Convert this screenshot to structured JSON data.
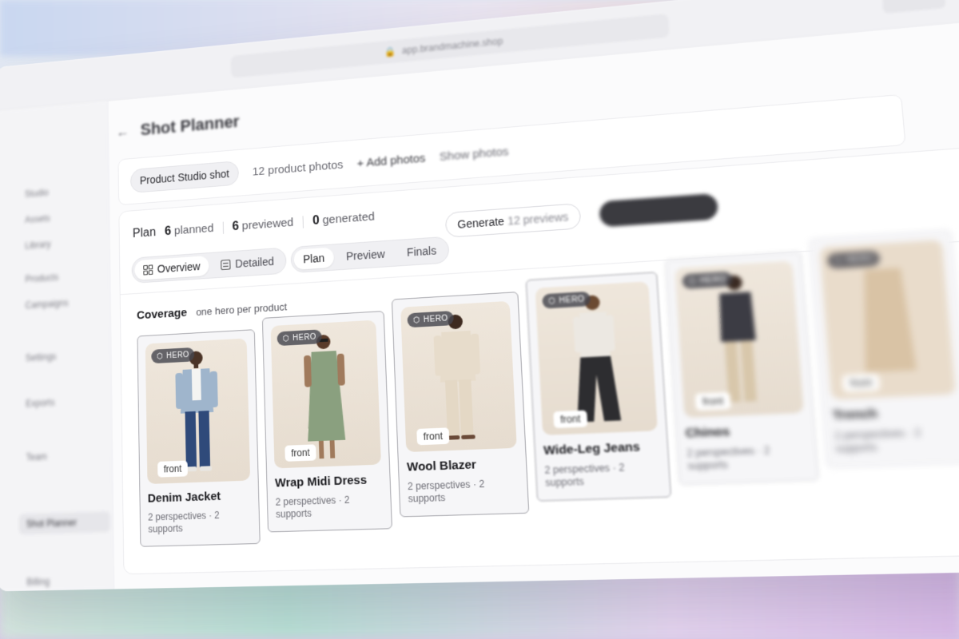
{
  "browser": {
    "url": "app.brandmachine.shop"
  },
  "sidebar": {
    "items": [
      "Studio",
      "Assets",
      "Library",
      "Products",
      "Campaigns",
      "Shot Planner",
      "Settings",
      "Exports",
      "Team",
      "Billing"
    ]
  },
  "header": {
    "back_label": "←",
    "title": "Shot Planner"
  },
  "toolbar": {
    "shot_type": "Product Studio shot",
    "photo_count": "12 product photos",
    "add_photos": "+ Add photos",
    "show_photos": "Show photos"
  },
  "plan": {
    "label": "Plan",
    "planned_count": "6",
    "planned_label": "planned",
    "previewed_count": "6",
    "previewed_label": "previewed",
    "generated_count": "0",
    "generated_label": "generated",
    "view_toggle": [
      {
        "label": "Overview",
        "icon": "grid-icon",
        "active": true
      },
      {
        "label": "Detailed",
        "icon": "list-icon",
        "active": false
      }
    ],
    "stage_tabs": [
      {
        "label": "Plan",
        "active": true
      },
      {
        "label": "Preview",
        "active": false
      },
      {
        "label": "Finals",
        "active": false
      }
    ],
    "generate_previews_prefix": "Generate",
    "generate_previews_suffix": "12 previews"
  },
  "coverage": {
    "title": "Coverage",
    "subtitle": "one hero per product"
  },
  "products": [
    {
      "name": "Denim Jacket",
      "badge": "HERO",
      "tag": "front",
      "meta": "2 perspectives · 2 supports"
    },
    {
      "name": "Wrap Midi Dress",
      "badge": "HERO",
      "tag": "front",
      "meta": "2 perspectives · 2 supports"
    },
    {
      "name": "Wool Blazer",
      "badge": "HERO",
      "tag": "front",
      "meta": "2 perspectives · 2 supports"
    },
    {
      "name": "Wide-Leg Jeans",
      "badge": "HERO",
      "tag": "front",
      "meta": "2 perspectives · 2 supports"
    },
    {
      "name": "Chinos",
      "badge": "HERO",
      "tag": "front",
      "meta": "2 perspectives · 2 supports"
    },
    {
      "name": "Trench",
      "badge": "HERO",
      "tag": "front",
      "meta": "2 perspectives · 2 supports"
    }
  ],
  "colors": {
    "accent_dark": "#3b3b40",
    "card_border": "#a7a7ad",
    "photo_bg": "#ebe3d7"
  }
}
